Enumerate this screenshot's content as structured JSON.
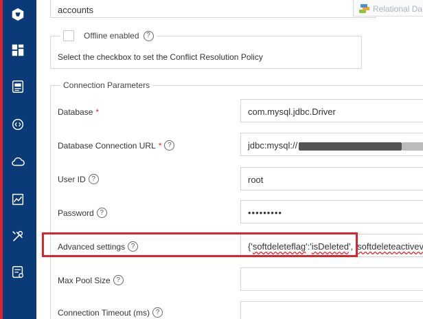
{
  "top_field": {
    "value": "accounts"
  },
  "relational": {
    "label": "Relational Da"
  },
  "offline": {
    "label": "Offline enabled",
    "help": "?",
    "hint": "Select the checkbox to set the Conflict Resolution Policy"
  },
  "connection": {
    "legend": "Connection Parameters",
    "database": {
      "label": "Database",
      "required": "*",
      "value": "com.mysql.jdbc.Driver"
    },
    "url": {
      "label": "Database Connection URL",
      "required": "*",
      "help": "?",
      "value_prefix": "jdbc:mysql://"
    },
    "user": {
      "label": "User ID",
      "help": "?",
      "value": "root"
    },
    "password": {
      "label": "Password",
      "help": "?",
      "value": "•••••••••"
    },
    "advanced": {
      "label": "Advanced settings",
      "help": "?",
      "value_open": "{'",
      "key1": "softdeleteflag",
      "mid": "':'",
      "val1": "isDeleted",
      "sep": "', '",
      "key2": "softdeleteactiveva"
    },
    "pool": {
      "label": "Max Pool Size",
      "help": "?",
      "value": ""
    },
    "timeout": {
      "label": "Connection Timeout (ms)",
      "help": "?",
      "value": ""
    }
  },
  "sidebar": {
    "items": [
      {
        "icon": "app-logo-icon"
      },
      {
        "icon": "dashboard-icon"
      },
      {
        "icon": "api-icon"
      },
      {
        "icon": "chat-code-icon"
      },
      {
        "icon": "cloud-icon"
      },
      {
        "icon": "analytics-icon"
      },
      {
        "icon": "tools-icon"
      },
      {
        "icon": "server-settings-icon"
      }
    ]
  },
  "colors": {
    "sidebar": "#0b3a78",
    "accent": "#d9252e"
  }
}
